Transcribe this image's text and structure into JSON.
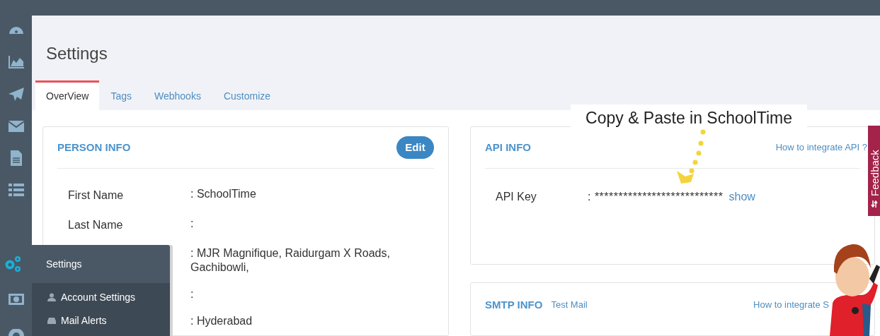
{
  "page": {
    "title": "Settings"
  },
  "flyout": {
    "title": "Settings",
    "items": [
      {
        "label": "Account Settings"
      },
      {
        "label": "Mail Alerts"
      }
    ]
  },
  "tabs": [
    {
      "label": "OverView",
      "selected": true
    },
    {
      "label": "Tags",
      "selected": false
    },
    {
      "label": "Webhooks",
      "selected": false
    },
    {
      "label": "Customize",
      "selected": false
    }
  ],
  "person_info": {
    "title": "PERSON INFO",
    "button": "Edit",
    "rows": [
      {
        "label": "First Name",
        "value": ": SchoolTime"
      },
      {
        "label": "Last Name",
        "value": ":"
      },
      {
        "value": ": MJR Magnifique, Raidurgam X Roads, Gachibowli,"
      },
      {
        "value": ":"
      },
      {
        "value": ": Hyderabad"
      }
    ]
  },
  "api_info": {
    "title": "API INFO",
    "link": "How to integrate API ?",
    "key_label": "API Key",
    "key_value": ": ***************************",
    "show": "show"
  },
  "tooltip": "Copy & Paste in SchoolTime",
  "smtp_info": {
    "title": "SMTP INFO",
    "test_link": "Test Mail",
    "link": "How to integrate S"
  },
  "feedback": "Feedback"
}
